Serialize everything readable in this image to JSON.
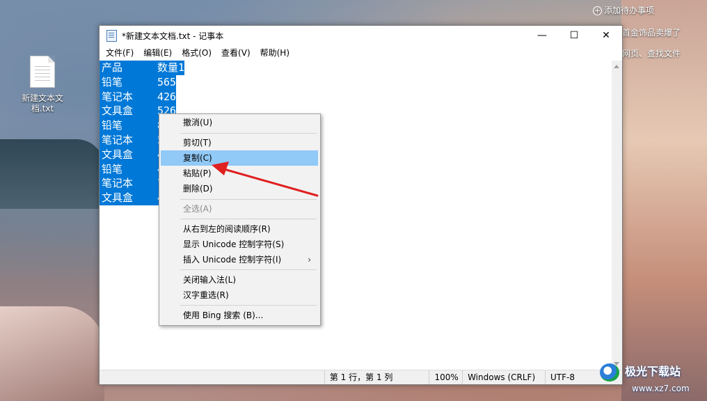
{
  "desktop": {
    "file_icon_label": "新建文本文档.txt",
    "overlay_top": "添加待办事项",
    "overlay_mid": "首金饰品卖爆了",
    "overlay_low": "网页、查找文件",
    "watermark": "极光下载站",
    "watermark_url": "www.xz7.com",
    "plus_icon": "plus-circle-icon"
  },
  "window": {
    "title": "*新建文本文档.txt - 记事本",
    "controls": {
      "minimize": "—",
      "maximize": "☐",
      "close": "✕"
    }
  },
  "menubar": [
    "文件(F)",
    "编辑(E)",
    "格式(O)",
    "查看(V)",
    "帮助(H)"
  ],
  "editor": {
    "lines": [
      [
        "产品",
        "数量1"
      ],
      [
        "铅笔",
        "565"
      ],
      [
        "笔记本",
        "426"
      ],
      [
        "文具盒",
        "526"
      ],
      [
        "铅笔",
        "8"
      ],
      [
        "笔记本",
        "5"
      ],
      [
        "文具盒",
        "4"
      ],
      [
        "铅笔",
        "4"
      ],
      [
        "笔记本",
        "7"
      ],
      [
        "文具盒",
        "4"
      ]
    ],
    "selection_color": "#0078d7"
  },
  "statusbar": {
    "position": "第 1 行，第 1 列",
    "zoom": "100%",
    "eol": "Windows (CRLF)",
    "encoding": "UTF-8"
  },
  "context_menu": {
    "undo": "撤消(U)",
    "cut": "剪切(T)",
    "copy": "复制(C)",
    "paste": "粘贴(P)",
    "delete": "删除(D)",
    "select_all": "全选(A)",
    "rtl": "从右到左的阅读顺序(R)",
    "show_unicode": "显示 Unicode 控制字符(S)",
    "insert_unicode": "插入 Unicode 控制字符(I)",
    "close_ime": "关闭输入法(L)",
    "reconvert": "汉字重选(R)",
    "bing": "使用 Bing 搜索 (B)...",
    "highlight_color": "#91c9f7"
  },
  "annotation": {
    "arrow_color": "#e02020"
  }
}
